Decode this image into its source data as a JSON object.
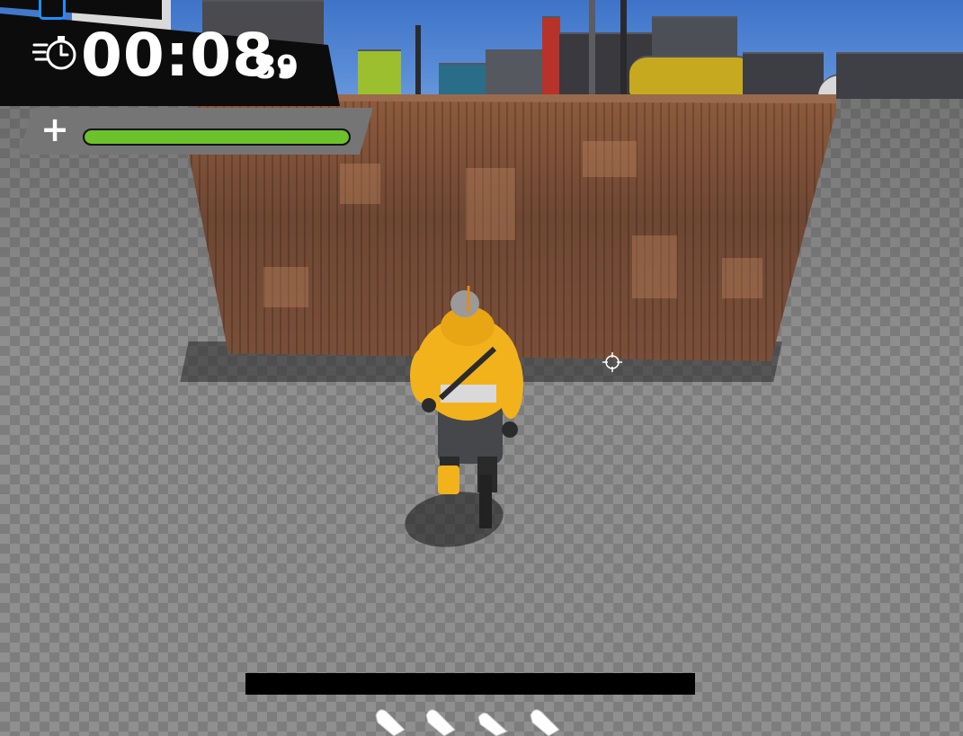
{
  "hud": {
    "timer": {
      "main": "00:08.",
      "fraction": "89"
    },
    "health": {
      "icon": "plus-icon",
      "value": 1.0,
      "color": "#6cc22a"
    },
    "top_badge_color": "#1e90ff",
    "ammo_slots": 4
  },
  "colors": {
    "sky": "#4a7fd0",
    "ground": "#8f8f8f",
    "container": "#7a4f39",
    "character_jacket": "#f2b21c"
  }
}
